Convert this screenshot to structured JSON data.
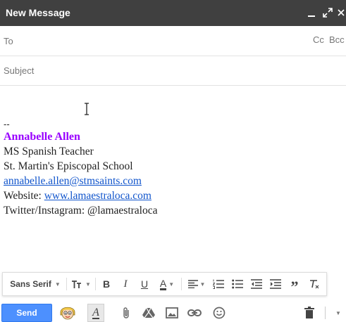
{
  "window": {
    "title": "New Message"
  },
  "fields": {
    "to_label": "To",
    "cc_label": "Cc",
    "bcc_label": "Bcc",
    "subject_label": "Subject"
  },
  "signature": {
    "dash": "--",
    "name": "Annabelle Allen",
    "line1": "MS Spanish Teacher",
    "line2": "St. Martin's Episcopal School",
    "email": "annabelle.allen@stmsaints.com",
    "website_label": "Website: ",
    "website": "www.lamaestraloca.com",
    "social": "Twitter/Instagram: @lamaestraloca"
  },
  "format_toolbar": {
    "font_family": "Sans Serif"
  },
  "actions": {
    "send_label": "Send"
  },
  "colors": {
    "titlebar": "#404040",
    "send": "#4d90fe",
    "signature_name": "#9900ff",
    "link": "#1155cc"
  }
}
